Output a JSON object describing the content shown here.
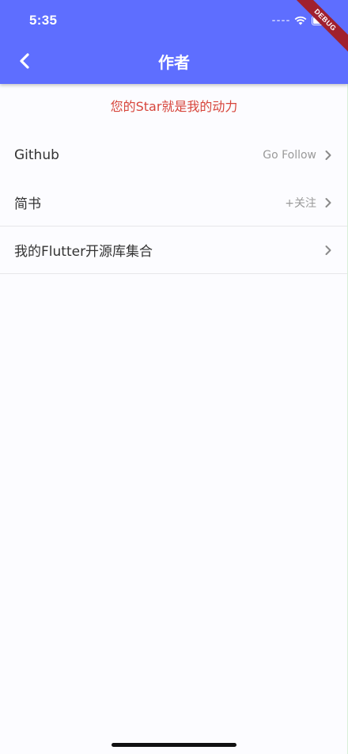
{
  "status_bar": {
    "time": "5:35"
  },
  "debug_banner": "DEBUG",
  "header": {
    "title": "作者"
  },
  "slogan": "您的Star就是我的动力",
  "list": [
    {
      "label": "Github",
      "value": "Go Follow"
    },
    {
      "label": "简书",
      "value": "+关注"
    },
    {
      "label": "我的Flutter开源库集合",
      "value": ""
    }
  ],
  "colors": {
    "appbar": "#5e6eff",
    "slogan": "#d7463c",
    "background": "#fcfcff"
  },
  "icons": [
    "back-arrow-icon",
    "wifi-icon",
    "battery-icon",
    "chevron-right-icon"
  ]
}
